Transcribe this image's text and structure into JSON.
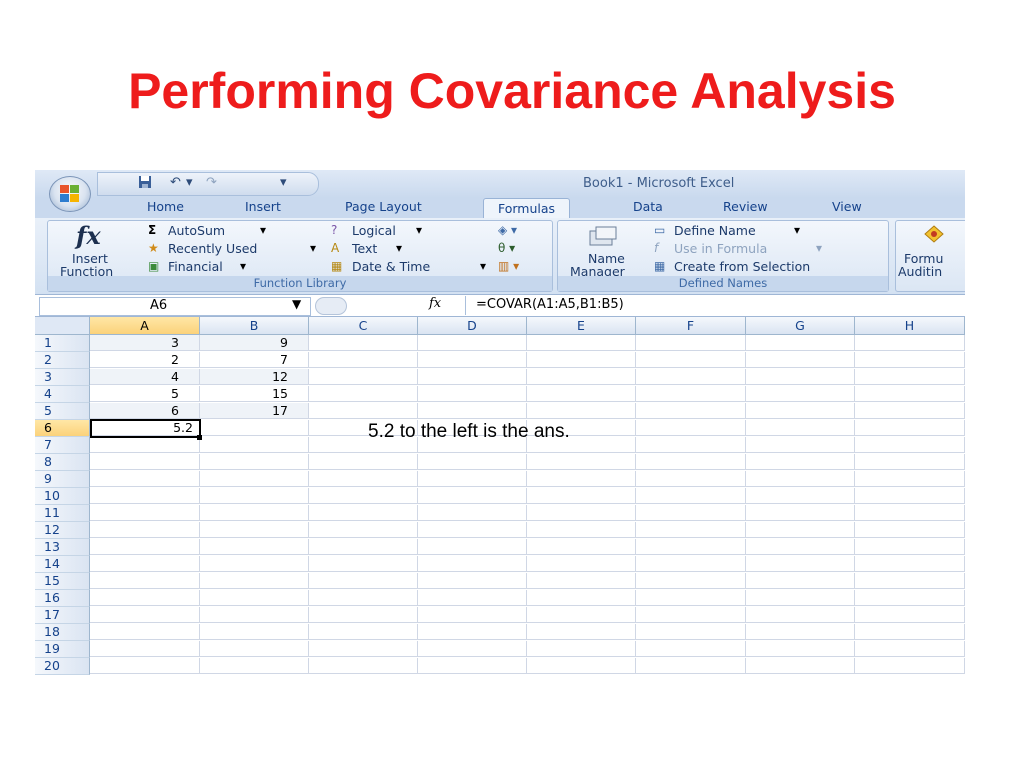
{
  "slide": {
    "title": "Performing Covariance Analysis"
  },
  "window": {
    "title": "Book1 - Microsoft Excel"
  },
  "quick_access": {
    "save_icon": "save-icon",
    "undo": "↶",
    "dropdown": "▾",
    "redo": "↷",
    "customize": "▾"
  },
  "tabs": [
    "Home",
    "Insert",
    "Page Layout",
    "Formulas",
    "Data",
    "Review",
    "View"
  ],
  "active_tab": "Formulas",
  "ribbon": {
    "insert_function": {
      "glyph": "fx",
      "line1": "Insert",
      "line2": "Function"
    },
    "function_library": {
      "label": "Function Library",
      "autosum": "AutoSum",
      "recently_used": "Recently Used",
      "financial": "Financial",
      "logical": "Logical",
      "text": "Text",
      "date_time": "Date & Time"
    },
    "defined_names": {
      "label": "Defined Names",
      "name_manager_1": "Name",
      "name_manager_2": "Manager",
      "define_name": "Define Name",
      "use_in_formula": "Use in Formula",
      "create_from_selection": "Create from Selection"
    },
    "formula_auditing": {
      "line1": "Formu",
      "line2": "Auditin"
    }
  },
  "formula_bar": {
    "name_box": "A6",
    "fx": "fx",
    "formula": "=COVAR(A1:A5,B1:B5)"
  },
  "columns": [
    "A",
    "B",
    "C",
    "D",
    "E",
    "F",
    "G",
    "H"
  ],
  "rows": [
    "1",
    "2",
    "3",
    "4",
    "5",
    "6",
    "7",
    "8",
    "9",
    "10",
    "11",
    "12",
    "13",
    "14",
    "15",
    "16",
    "17",
    "18",
    "19",
    "20"
  ],
  "cells": {
    "A": [
      "3",
      "2",
      "4",
      "5",
      "6",
      "5.2"
    ],
    "B": [
      "9",
      "7",
      "12",
      "15",
      "17"
    ]
  },
  "annotation": "5.2 to the left is the ans."
}
